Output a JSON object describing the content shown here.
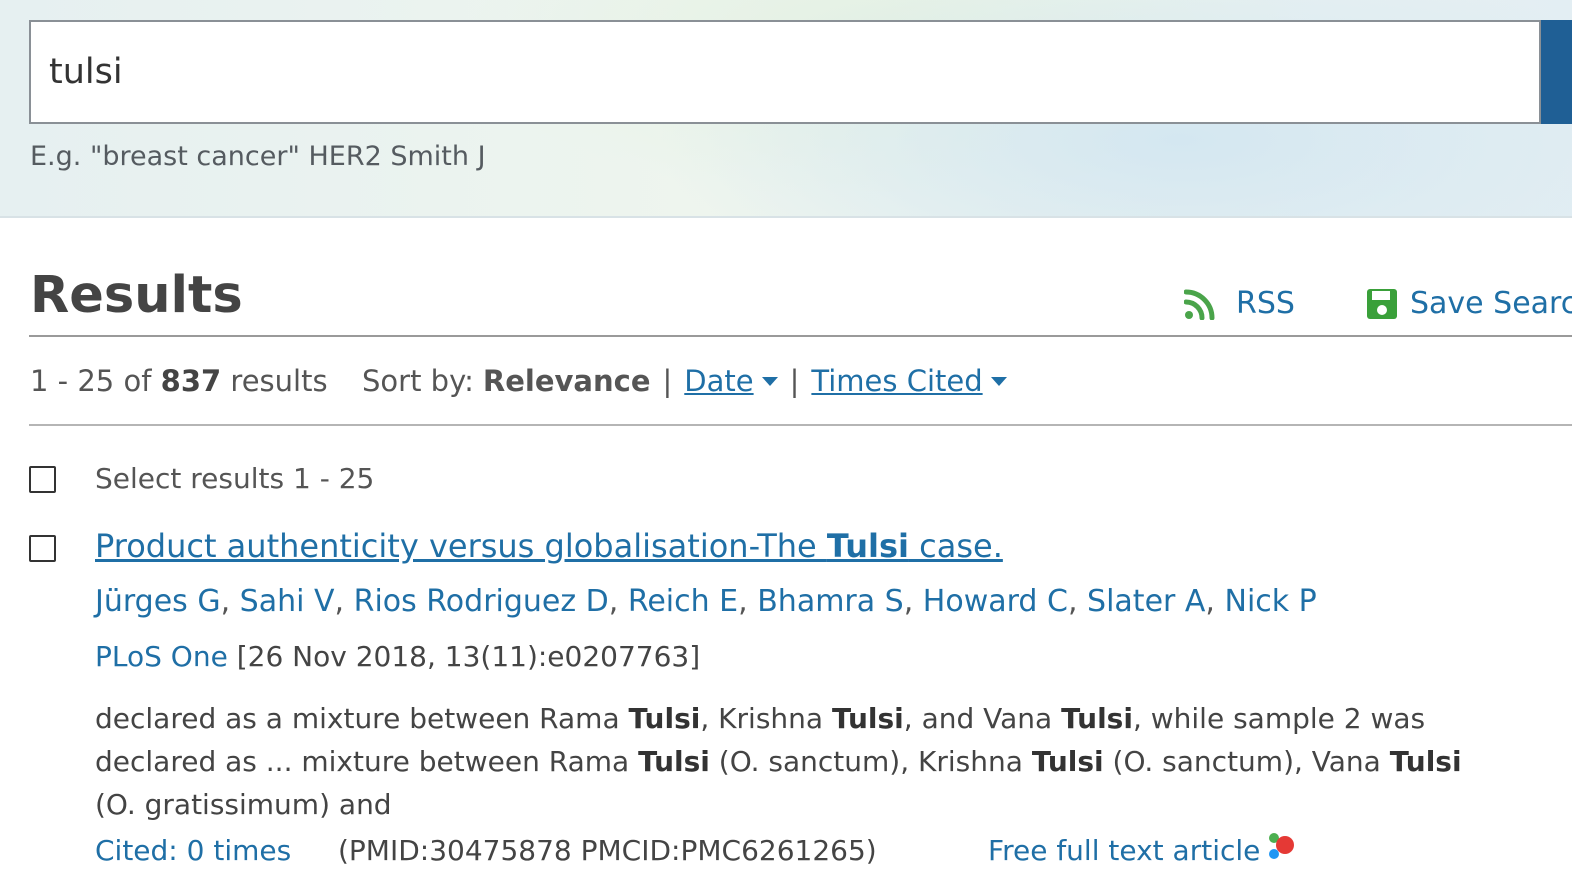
{
  "search": {
    "value": "tulsi",
    "hint": "E.g. \"breast cancer\" HER2 Smith J"
  },
  "results": {
    "title": "Results",
    "rss_label": "RSS",
    "save_label": "Save Search",
    "count_prefix": "1 - 25 of ",
    "count_total": "837",
    "count_suffix": " results",
    "sort_label": "Sort by:",
    "sort_active": "Relevance",
    "sort_date": "Date",
    "sort_times_cited": "Times Cited",
    "separator": "|",
    "select_label": "Select results 1 - 25"
  },
  "article": {
    "title_pre": "Product authenticity versus globalisation-The ",
    "title_bold": "Tulsi",
    "title_post": " case.",
    "authors": [
      "Jürges G",
      "Sahi V",
      "Rios Rodriguez D",
      "Reich E",
      "Bhamra S",
      "Howard C",
      "Slater A",
      "Nick P"
    ],
    "journal": "PLoS One",
    "citation": " [26 Nov 2018, 13(11):e0207763]",
    "snippet": [
      {
        "t": "declared as a mixture between Rama ",
        "b": false
      },
      {
        "t": "Tulsi",
        "b": true
      },
      {
        "t": ", Krishna ",
        "b": false
      },
      {
        "t": "Tulsi",
        "b": true
      },
      {
        "t": ", and Vana ",
        "b": false
      },
      {
        "t": "Tulsi",
        "b": true
      },
      {
        "t": ", while sample 2 was declared as ... mixture between Rama ",
        "b": false
      },
      {
        "t": "Tulsi",
        "b": true
      },
      {
        "t": " (O. sanctum), Krishna ",
        "b": false
      },
      {
        "t": "Tulsi",
        "b": true
      },
      {
        "t": " (O. sanctum), Vana ",
        "b": false
      },
      {
        "t": "Tulsi",
        "b": true
      },
      {
        "t": " (O. gratissimum) and",
        "b": false
      }
    ],
    "cited": "Cited: 0 times",
    "ids": "(PMID:30475878 PMCID:PMC6261265)",
    "fulltext": "Free full text article"
  },
  "colors": {
    "link": "#1f6fa6",
    "save_icon": "#3aa03a",
    "rss_icon": "#4aa44a",
    "search_button": "#1f5f95"
  },
  "icons": {
    "rss": "rss-icon",
    "save": "floppy-disk-icon",
    "fulltext": "open-access-dots-icon",
    "sort_caret": "caret-down-icon"
  }
}
